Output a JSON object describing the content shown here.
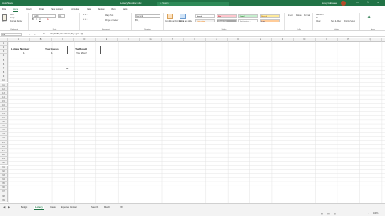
{
  "window": {
    "autosave_label": "AutoSave",
    "file_title": "Lottery Number.xlsx",
    "search_placeholder": "Search",
    "user_name": "Greg Gabaree",
    "min": "—",
    "max": "☐",
    "close": "✕"
  },
  "ribbon_tabs": [
    "File",
    "Home",
    "Insert",
    "Draw",
    "Page Layout",
    "Formulas",
    "Data",
    "Review",
    "View",
    "Help"
  ],
  "ribbon": {
    "clipboard": {
      "paste": "Paste",
      "cut": "Cut",
      "copy": "Copy",
      "format_painter": "Format Painter",
      "label": "Clipboard"
    },
    "font": {
      "name": "Calibri",
      "size": "11",
      "label": "Font"
    },
    "alignment": {
      "wrap": "Wrap Text",
      "merge": "Merge & Center",
      "label": "Alignment"
    },
    "number": {
      "format": "General",
      "label": "Number"
    },
    "styles": {
      "conditional": "Conditional Formatting",
      "format_table": "Format as Table",
      "label": "Styles",
      "cells": [
        {
          "text": "Normal",
          "bg": "#ffffff",
          "fg": "#000000"
        },
        {
          "text": "Bad",
          "bg": "#ffc7ce",
          "fg": "#9c0006"
        },
        {
          "text": "Good",
          "bg": "#c6efce",
          "fg": "#006100"
        },
        {
          "text": "Neutral",
          "bg": "#ffeb9c",
          "fg": "#9c5700"
        },
        {
          "text": "Calculation",
          "bg": "#f2f2f2",
          "fg": "#fa7d00"
        },
        {
          "text": "Check Cell",
          "bg": "#a5a5a5",
          "fg": "#ffffff"
        },
        {
          "text": "Explanatory ...",
          "bg": "#ffffff",
          "fg": "#7f7f7f"
        },
        {
          "text": "Input",
          "bg": "#ffcc99",
          "fg": "#3f3f76"
        }
      ]
    },
    "cells_group": {
      "insert": "Insert",
      "delete": "Delete",
      "format": "Format",
      "label": "Cells"
    },
    "editing": {
      "autosum": "AutoSum",
      "fill": "Fill",
      "clear": "Clear",
      "sort": "Sort & Filter",
      "find": "Find & Select",
      "label": "Editing"
    },
    "ideas": {
      "label": "Ideas"
    }
  },
  "formula_bar": {
    "name_box": "C2",
    "fx": "fx",
    "formula": "=IF(A2=B2,\"You Won!\",\"Try Again :(\")"
  },
  "columns": [
    "A",
    "B",
    "C",
    "D",
    "E",
    "F",
    "G",
    "H",
    "I",
    "J",
    "K",
    "L",
    "M",
    "N",
    "O",
    "P",
    "Q",
    "R"
  ],
  "rows": [
    "1",
    "2",
    "3",
    "4",
    "5",
    "6",
    "7",
    "8",
    "9",
    "10",
    "11",
    "12",
    "13",
    "14",
    "15",
    "16",
    "17",
    "18",
    "19",
    "20",
    "21",
    "22",
    "23",
    "24",
    "25",
    "26",
    "27",
    "28",
    "29",
    "30",
    "31",
    "32",
    "33",
    "34",
    "35",
    "36",
    "37",
    "38",
    "39"
  ],
  "cells": {
    "a1": "Lottery Number",
    "b1": "Your Guess",
    "c1": "The Result",
    "a2": "1",
    "b2": "1",
    "c2": "You Won!"
  },
  "sheet_tabs": [
    "Budget",
    "Lottery",
    "Create",
    "Expense Contour",
    "Search",
    "Match"
  ],
  "active_sheet": "Lottery",
  "status": {
    "zoom": "100%"
  }
}
